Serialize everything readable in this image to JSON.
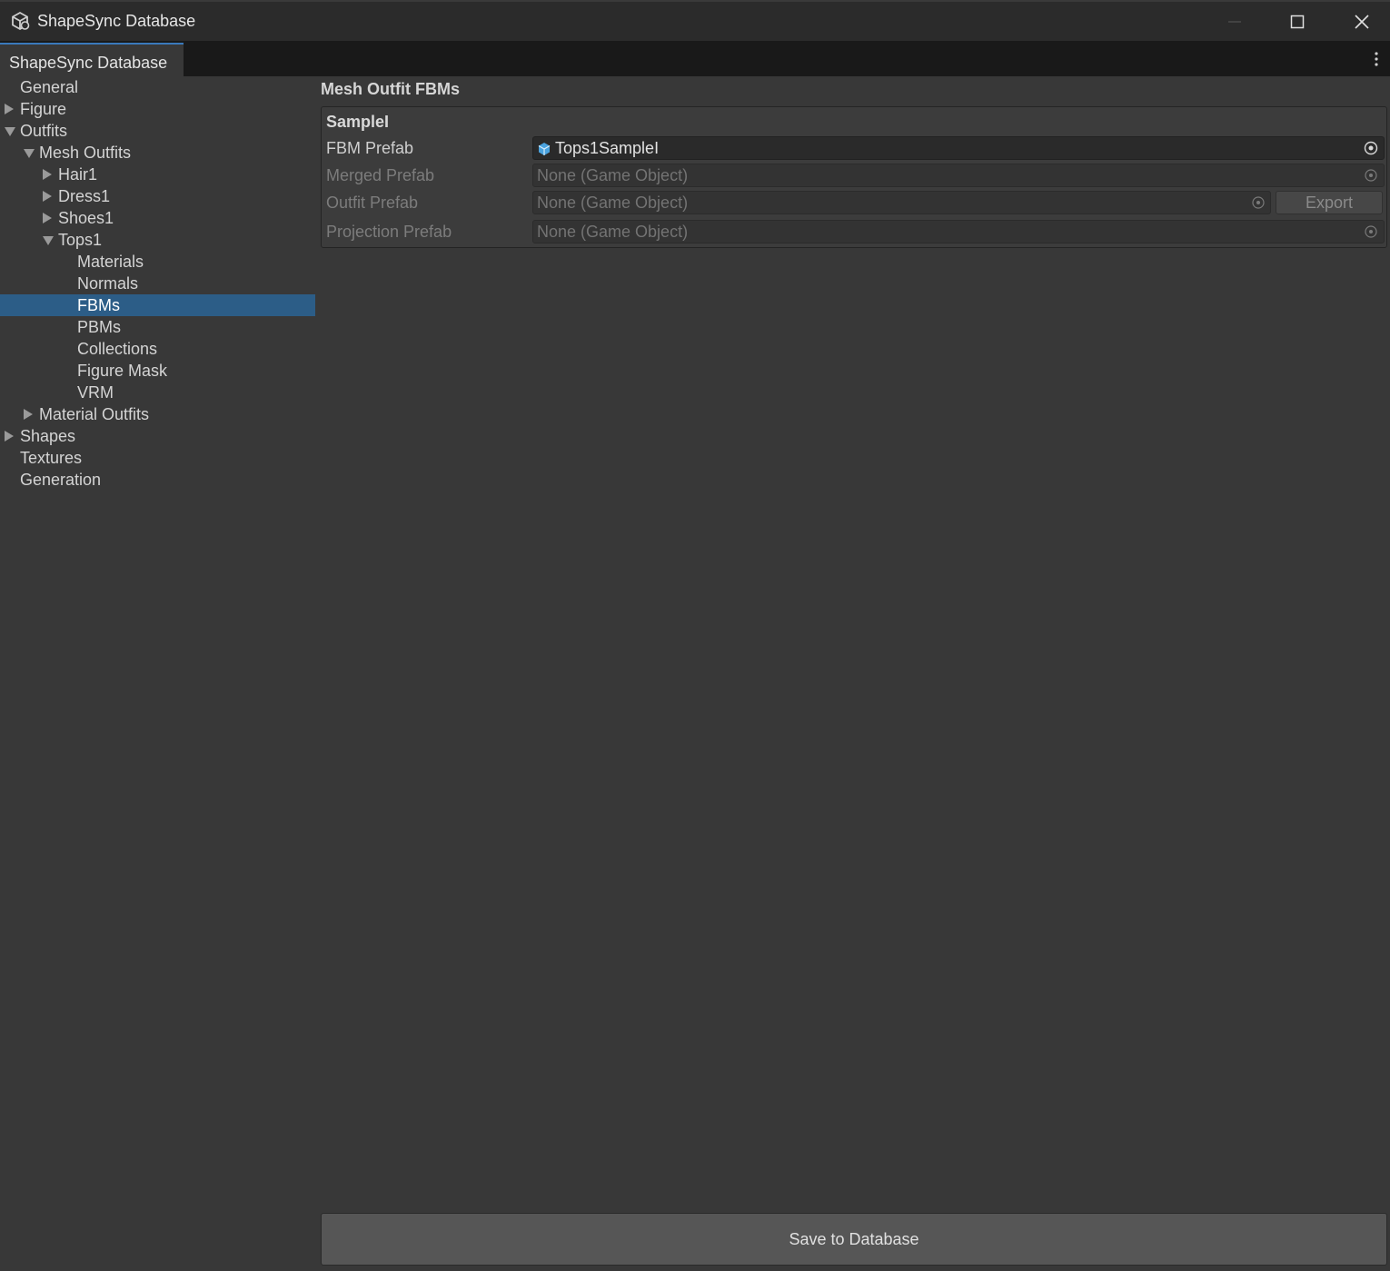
{
  "window": {
    "title": "ShapeSync Database",
    "icons": {
      "app": "unity-cube-icon",
      "minimize": "minimize-icon",
      "maximize": "maximize-icon",
      "close": "close-icon"
    }
  },
  "tabs": {
    "active": "ShapeSync Database",
    "menu_icon": "kebab-menu-icon"
  },
  "sidebar": {
    "selection_color": "#2c5d87",
    "items": [
      {
        "label": "General",
        "level": 0,
        "expander": "none"
      },
      {
        "label": "Figure",
        "level": 0,
        "expander": "collapsed"
      },
      {
        "label": "Outfits",
        "level": 0,
        "expander": "expanded"
      },
      {
        "label": "Mesh Outfits",
        "level": 1,
        "expander": "expanded"
      },
      {
        "label": "Hair1",
        "level": 2,
        "expander": "collapsed"
      },
      {
        "label": "Dress1",
        "level": 2,
        "expander": "collapsed"
      },
      {
        "label": "Shoes1",
        "level": 2,
        "expander": "collapsed"
      },
      {
        "label": "Tops1",
        "level": 2,
        "expander": "expanded"
      },
      {
        "label": "Materials",
        "level": 3,
        "expander": "none"
      },
      {
        "label": "Normals",
        "level": 3,
        "expander": "none"
      },
      {
        "label": "FBMs",
        "level": 3,
        "expander": "none",
        "selected": true
      },
      {
        "label": "PBMs",
        "level": 3,
        "expander": "none"
      },
      {
        "label": "Collections",
        "level": 3,
        "expander": "none"
      },
      {
        "label": "Figure Mask",
        "level": 3,
        "expander": "none"
      },
      {
        "label": "VRM",
        "level": 3,
        "expander": "none"
      },
      {
        "label": "Material Outfits",
        "level": 1,
        "expander": "collapsed"
      },
      {
        "label": "Shapes",
        "level": 0,
        "expander": "collapsed"
      },
      {
        "label": "Textures",
        "level": 0,
        "expander": "none"
      },
      {
        "label": "Generation",
        "level": 0,
        "expander": "none"
      }
    ]
  },
  "main": {
    "section_title": "Mesh Outfit FBMs",
    "group": {
      "title": "SampleI",
      "fields": [
        {
          "label": "FBM Prefab",
          "value": "Tops1SampleI",
          "enabled": true,
          "has_object_icon": true
        },
        {
          "label": "Merged Prefab",
          "value": "None (Game Object)",
          "enabled": false
        },
        {
          "label": "Outfit Prefab",
          "value": "None (Game Object)",
          "enabled": false,
          "button": "Export"
        },
        {
          "label": "Projection Prefab",
          "value": "None (Game Object)",
          "enabled": false
        }
      ]
    },
    "save_button": "Save to Database"
  }
}
